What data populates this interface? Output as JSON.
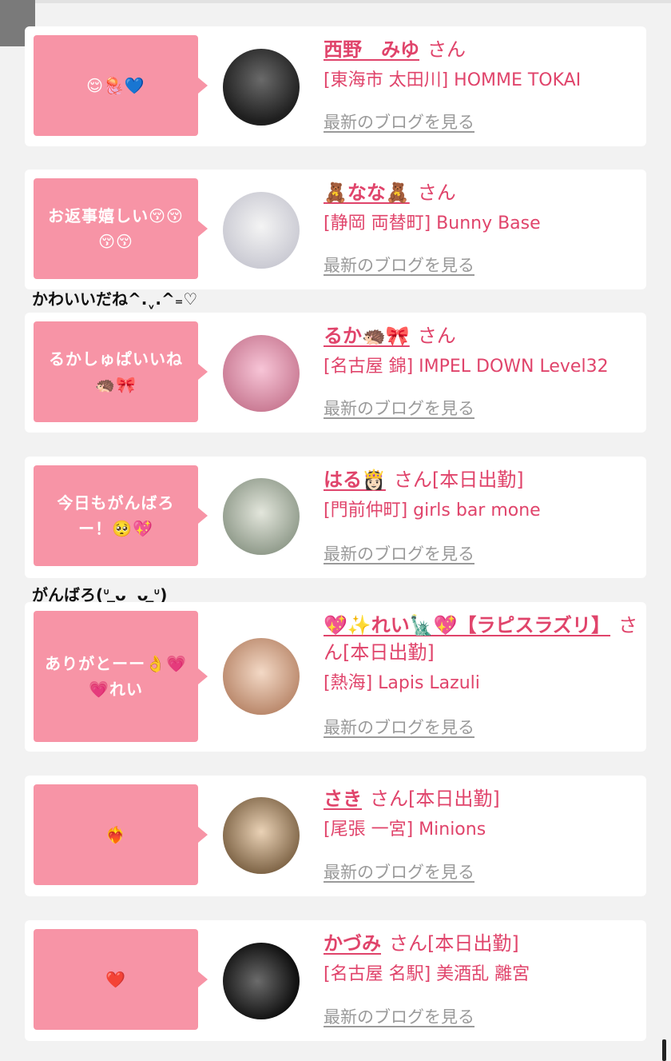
{
  "colors": {
    "bubble": "#f794a6",
    "name": "#e0446b",
    "link": "#9a9a9a",
    "card": "#ffffff",
    "background": "#f2f2f2"
  },
  "san": "さん",
  "blog_link": "最新のブログを見る",
  "entries": [
    {
      "message": "😌🪼💙",
      "name": "西野　みゆ",
      "status": "",
      "shop": "[東海市 太田川] HOMME TOKAI",
      "reply": "",
      "avatar_icon": "avatar-photo"
    },
    {
      "message": "お返事嬉しい😚😚😚😚",
      "name": "🧸なな🧸",
      "status": "",
      "shop": "[静岡 両替町] Bunny Base",
      "reply": "かわいいだね^.ˬ.^₌♡",
      "avatar_icon": "avatar-photo"
    },
    {
      "message": "るかしゅぱいいね🦔🎀",
      "name": "るか🦔🎀",
      "status": "",
      "shop": "[名古屋 錦] IMPEL DOWN Level32",
      "reply": "",
      "avatar_icon": "avatar-photo"
    },
    {
      "message": "今日もがんばろー！🥺💖",
      "name": "はる👸🏻",
      "status": "[本日出勤]",
      "shop": "[門前仲町] girls bar mone",
      "reply": "がんばろ(ᐡ ̳ᴗ ̫ ᴗ ̳ᐡ)",
      "avatar_icon": "avatar-photo"
    },
    {
      "message": "ありがとーー👌💗💗れい",
      "name": "💖✨れい🗽💖【ラピスラズリ】",
      "status": "[本日出勤]",
      "shop": "[熱海] Lapis Lazuli",
      "reply": "",
      "avatar_icon": "avatar-photo"
    },
    {
      "message": "❤️‍🔥",
      "name": "さき",
      "status": "[本日出勤]",
      "shop": "[尾張 一宮] Minions",
      "reply": "",
      "avatar_icon": "avatar-photo"
    },
    {
      "message": "❤️",
      "name": "かづみ",
      "status": "[本日出勤]",
      "shop": "[名古屋 名駅] 美酒乱 離宮",
      "reply": "",
      "avatar_icon": "avatar-photo"
    }
  ]
}
